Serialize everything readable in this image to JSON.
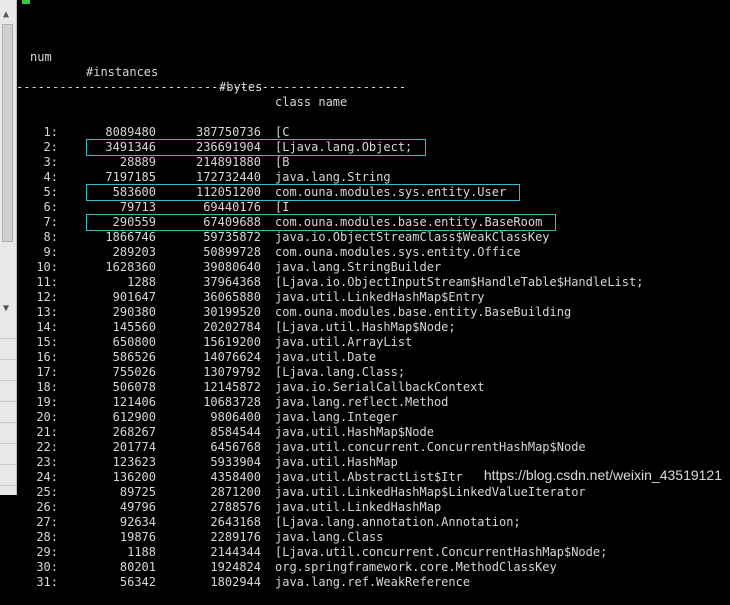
{
  "header": {
    "num": "num",
    "instances": "#instances",
    "bytes": "#bytes",
    "class_name": "class name"
  },
  "separator": "------------------------------------------------------",
  "rows": [
    {
      "num": "1:",
      "instances": "8089480",
      "bytes": "387750736",
      "class": "[C"
    },
    {
      "num": "2:",
      "instances": "3491346",
      "bytes": "236691904",
      "class": "[Ljava.lang.Object;"
    },
    {
      "num": "3:",
      "instances": "28889",
      "bytes": "214891880",
      "class": "[B"
    },
    {
      "num": "4:",
      "instances": "7197185",
      "bytes": "172732440",
      "class": "java.lang.String"
    },
    {
      "num": "5:",
      "instances": "583600",
      "bytes": "112051200",
      "class": "com.ouna.modules.sys.entity.User"
    },
    {
      "num": "6:",
      "instances": "79713",
      "bytes": "69440176",
      "class": "[I"
    },
    {
      "num": "7:",
      "instances": "290559",
      "bytes": "67409688",
      "class": "com.ouna.modules.base.entity.BaseRoom"
    },
    {
      "num": "8:",
      "instances": "1866746",
      "bytes": "59735872",
      "class": "java.io.ObjectStreamClass$WeakClassKey"
    },
    {
      "num": "9:",
      "instances": "289203",
      "bytes": "50899728",
      "class": "com.ouna.modules.sys.entity.Office"
    },
    {
      "num": "10:",
      "instances": "1628360",
      "bytes": "39080640",
      "class": "java.lang.StringBuilder"
    },
    {
      "num": "11:",
      "instances": "1288",
      "bytes": "37964368",
      "class": "[Ljava.io.ObjectInputStream$HandleTable$HandleList;"
    },
    {
      "num": "12:",
      "instances": "901647",
      "bytes": "36065880",
      "class": "java.util.LinkedHashMap$Entry"
    },
    {
      "num": "13:",
      "instances": "290380",
      "bytes": "30199520",
      "class": "com.ouna.modules.base.entity.BaseBuilding"
    },
    {
      "num": "14:",
      "instances": "145560",
      "bytes": "20202784",
      "class": "[Ljava.util.HashMap$Node;"
    },
    {
      "num": "15:",
      "instances": "650800",
      "bytes": "15619200",
      "class": "java.util.ArrayList"
    },
    {
      "num": "16:",
      "instances": "586526",
      "bytes": "14076624",
      "class": "java.util.Date"
    },
    {
      "num": "17:",
      "instances": "755026",
      "bytes": "13079792",
      "class": "[Ljava.lang.Class;"
    },
    {
      "num": "18:",
      "instances": "506078",
      "bytes": "12145872",
      "class": "java.io.SerialCallbackContext"
    },
    {
      "num": "19:",
      "instances": "121406",
      "bytes": "10683728",
      "class": "java.lang.reflect.Method"
    },
    {
      "num": "20:",
      "instances": "612900",
      "bytes": "9806400",
      "class": "java.lang.Integer"
    },
    {
      "num": "21:",
      "instances": "268267",
      "bytes": "8584544",
      "class": "java.util.HashMap$Node"
    },
    {
      "num": "22:",
      "instances": "201774",
      "bytes": "6456768",
      "class": "java.util.concurrent.ConcurrentHashMap$Node"
    },
    {
      "num": "23:",
      "instances": "123623",
      "bytes": "5933904",
      "class": "java.util.HashMap"
    },
    {
      "num": "24:",
      "instances": "136200",
      "bytes": "4358400",
      "class": "java.util.AbstractList$Itr"
    },
    {
      "num": "25:",
      "instances": "89725",
      "bytes": "2871200",
      "class": "java.util.LinkedHashMap$LinkedValueIterator"
    },
    {
      "num": "26:",
      "instances": "49796",
      "bytes": "2788576",
      "class": "java.util.LinkedHashMap"
    },
    {
      "num": "27:",
      "instances": "92634",
      "bytes": "2643168",
      "class": "[Ljava.lang.annotation.Annotation;"
    },
    {
      "num": "28:",
      "instances": "19876",
      "bytes": "2289176",
      "class": "java.lang.Class"
    },
    {
      "num": "29:",
      "instances": "1188",
      "bytes": "2144344",
      "class": "[Ljava.util.concurrent.ConcurrentHashMap$Node;"
    },
    {
      "num": "30:",
      "instances": "80201",
      "bytes": "1924824",
      "class": "org.springframework.core.MethodClassKey"
    },
    {
      "num": "31:",
      "instances": "56342",
      "bytes": "1802944",
      "class": "java.lang.ref.WeakReference"
    }
  ],
  "highlighted_rows": [
    "2:",
    "5:",
    "7:"
  ],
  "watermark": "https://blog.csdn.net/weixin_43519121",
  "colors": {
    "background": "#000000",
    "text": "#d6d6d6",
    "highlight_border": "#3fb9c4",
    "cursor": "#2ecc40"
  },
  "icons": {
    "scroll_up": "triangle-up-icon",
    "scroll_down": "triangle-down-icon"
  }
}
